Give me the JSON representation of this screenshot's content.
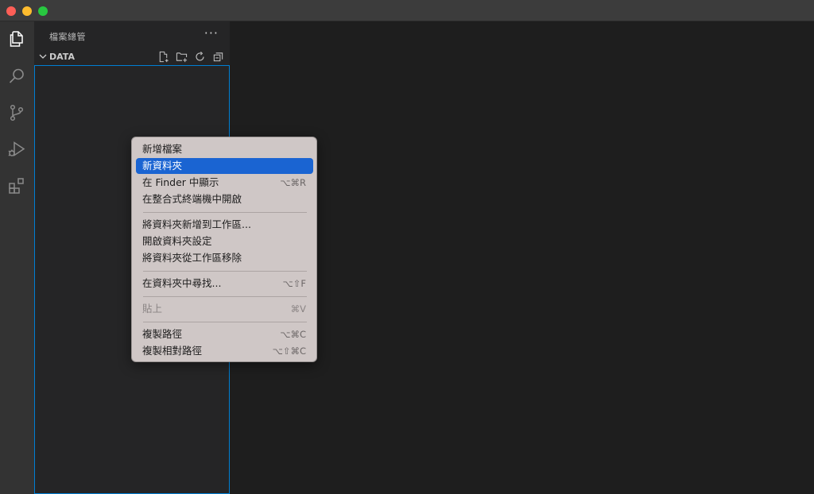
{
  "sidebar": {
    "title": "檔案總管",
    "more": "···",
    "section": "DATA"
  },
  "icons": {
    "activity": [
      "files-icon",
      "search-icon",
      "source-control-icon",
      "run-debug-icon",
      "extensions-icon"
    ],
    "section_actions": [
      "new-file-icon",
      "new-folder-icon",
      "refresh-icon",
      "collapse-all-icon"
    ]
  },
  "menu": {
    "items": [
      {
        "label": "新增檔案",
        "shortcut": ""
      },
      {
        "label": "新資料夾",
        "shortcut": ""
      },
      {
        "label": "在 Finder 中顯示",
        "shortcut": "⌥⌘R"
      },
      {
        "label": "在整合式終端機中開啟",
        "shortcut": ""
      },
      {
        "label": "將資料夾新增到工作區...",
        "shortcut": ""
      },
      {
        "label": "開啟資料夾設定",
        "shortcut": ""
      },
      {
        "label": "將資料夾從工作區移除",
        "shortcut": ""
      },
      {
        "label": "在資料夾中尋找...",
        "shortcut": "⌥⇧F"
      },
      {
        "label": "貼上",
        "shortcut": "⌘V"
      },
      {
        "label": "複製路徑",
        "shortcut": "⌥⌘C"
      },
      {
        "label": "複製相對路徑",
        "shortcut": "⌥⇧⌘C"
      }
    ]
  },
  "colors": {
    "highlight": "#1a64d2",
    "focus_border": "#007fd4",
    "activity_bar": "#333333",
    "sidebar": "#252526",
    "editor": "#1e1e1e"
  }
}
